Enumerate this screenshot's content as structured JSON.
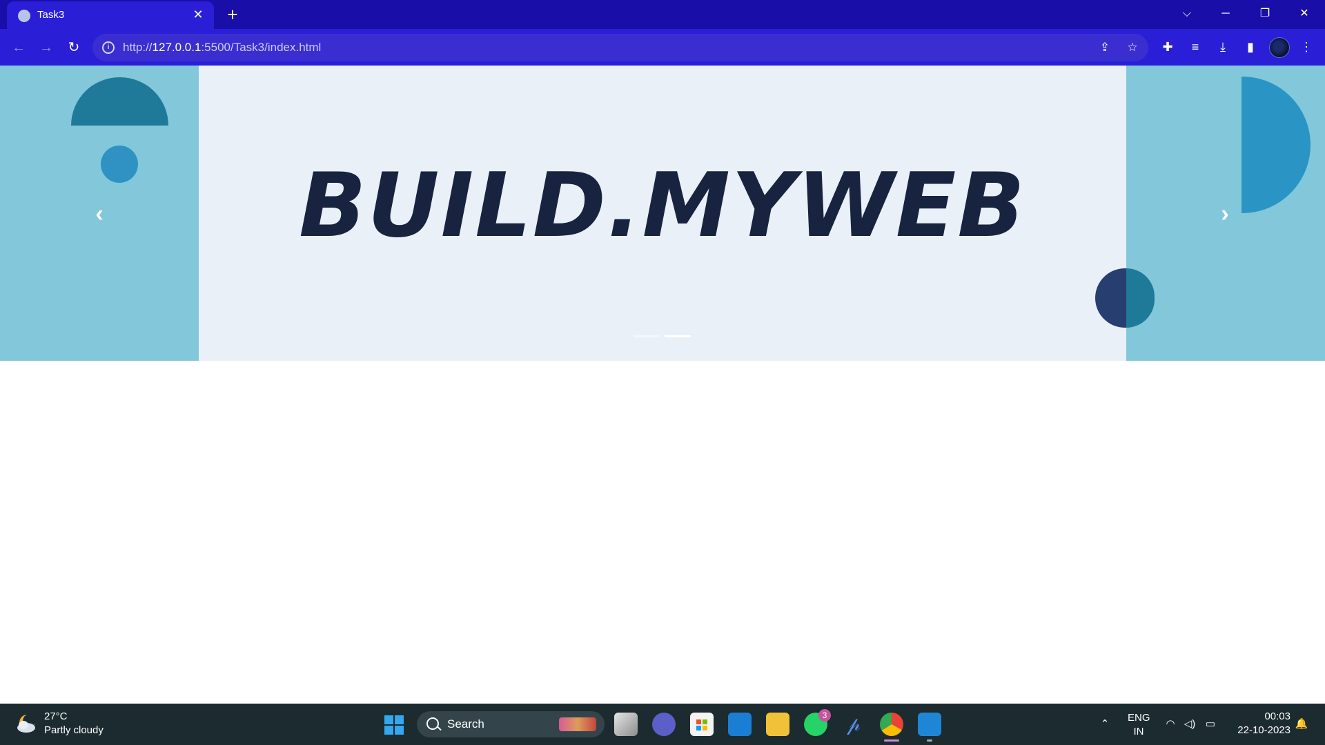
{
  "browser": {
    "tab": {
      "title": "Task3",
      "close": "✕"
    },
    "new_tab": "+",
    "window_controls": {
      "list": "⌵",
      "minimize": "─",
      "restore": "❐",
      "close": "✕"
    },
    "nav": {
      "back": "←",
      "forward": "→",
      "reload": "↻"
    },
    "omnibox": {
      "scheme": "http://",
      "host": "127.0.0.1",
      "path": ":5500/Task3/index.html",
      "info": "i"
    },
    "icons": {
      "share": "⇪",
      "bookmark": "☆",
      "extensions": "✚",
      "media": "≡",
      "download": "⤓",
      "sidepanel": "▮",
      "menu": "⋮"
    }
  },
  "page": {
    "carousel": {
      "headline": "BUILD.MYWEB",
      "prev": "‹",
      "next": "›",
      "active_slide_index": 1,
      "slide_count": 2
    }
  },
  "taskbar": {
    "weather": {
      "temp": "27°C",
      "desc": "Partly cloudy"
    },
    "search": {
      "label": "Search"
    },
    "whatsapp_badge": "3",
    "tray": {
      "chevron": "⌃",
      "lang": "ENG",
      "region": "IN",
      "wifi": "◠",
      "volume": "◁)",
      "battery": "▭",
      "time": "00:03",
      "date": "22-10-2023",
      "notify": "🔔"
    }
  }
}
